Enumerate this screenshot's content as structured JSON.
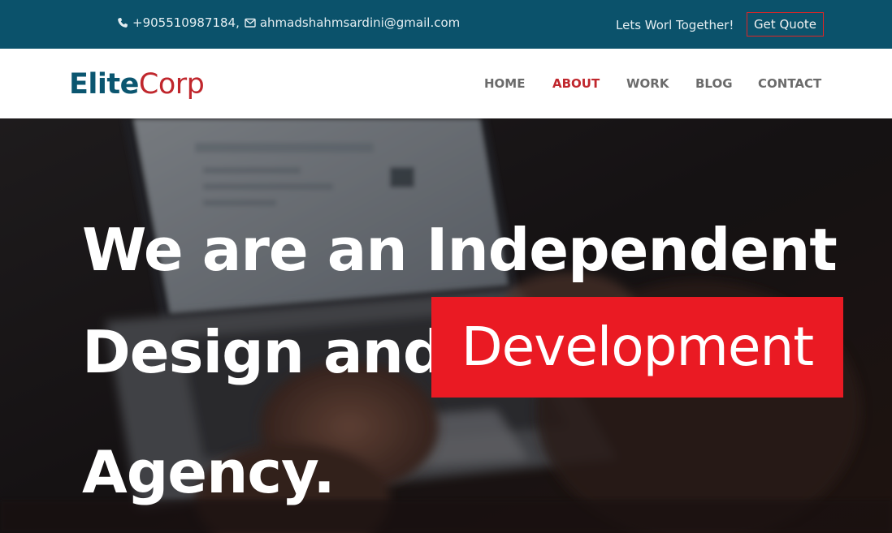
{
  "colors": {
    "topbar_bg": "#0b526b",
    "brand_dark": "#0b5670",
    "brand_red": "#c0272d",
    "highlight_red": "#ea1a23",
    "nav_text": "#6b6b6b"
  },
  "topbar": {
    "phone_icon": "phone-icon",
    "phone": "+905510987184,",
    "email_icon": "envelope-icon",
    "email": "ahmadshahmsardini@gmail.com",
    "tagline": "Lets Worl Together!",
    "quote_button": "Get Quote"
  },
  "brand": {
    "part1": "Elite",
    "part2": "Corp"
  },
  "nav": {
    "items": [
      {
        "label": "HOME",
        "active": false
      },
      {
        "label": "ABOUT",
        "active": true
      },
      {
        "label": "WORK",
        "active": false
      },
      {
        "label": "BLOG",
        "active": false
      },
      {
        "label": "CONTACT",
        "active": false
      }
    ]
  },
  "hero": {
    "line1": "We are an Independent",
    "line2": "Design and",
    "highlight": "Development",
    "line3": "Agency."
  }
}
